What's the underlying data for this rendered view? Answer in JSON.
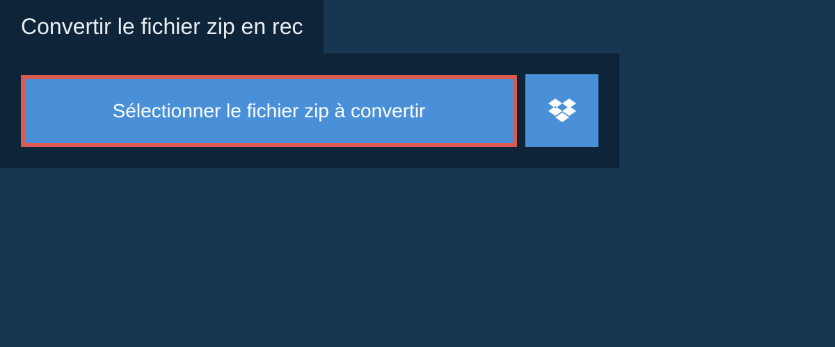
{
  "header": {
    "title": "Convertir le fichier zip en rec"
  },
  "actions": {
    "select_file_label": "Sélectionner le fichier zip à convertir",
    "dropbox_icon": "dropbox"
  }
}
